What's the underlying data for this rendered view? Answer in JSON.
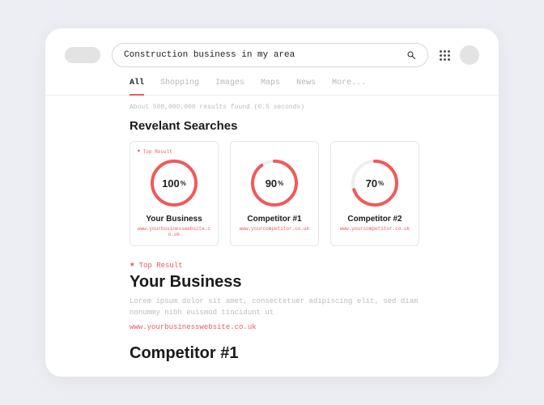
{
  "search": {
    "value": "Construction business in my area"
  },
  "tabs": {
    "all": "All",
    "shopping": "Shopping",
    "images": "Images",
    "maps": "Maps",
    "news": "News",
    "more": "More..."
  },
  "stats": "About 500,000,000 results found (0.5 seconds)",
  "sections": {
    "relevant": "Revelant Searches"
  },
  "top_result_label": "Top Result",
  "cards": [
    {
      "title": "Your Business",
      "url": "www.yourbusinesswebsite.co.uk",
      "percent": 100,
      "top": true
    },
    {
      "title": "Competitor #1",
      "url": "www.yourcompetitor.co.uk",
      "percent": 90,
      "top": false
    },
    {
      "title": "Competitor #2",
      "url": "www.yourcompetitor.co.uk",
      "percent": 70,
      "top": false
    }
  ],
  "results": [
    {
      "top": true,
      "title": "Your Business",
      "desc": "Lorem ipsum dolor sit amet, consectetuer adipiscing elit, sed diam nonummy nibh euismod tincidunt ut",
      "url": "www.yourbusinesswebsite.co.uk"
    },
    {
      "top": false,
      "title": "Competitor #1",
      "desc": "",
      "url": ""
    }
  ],
  "chart_data": {
    "type": "pie",
    "series": [
      {
        "name": "Your Business",
        "values": [
          100
        ]
      },
      {
        "name": "Competitor #1",
        "values": [
          90
        ]
      },
      {
        "name": "Competitor #2",
        "values": [
          70
        ]
      }
    ],
    "title": "Revelant Searches",
    "ylim": [
      0,
      100
    ]
  }
}
